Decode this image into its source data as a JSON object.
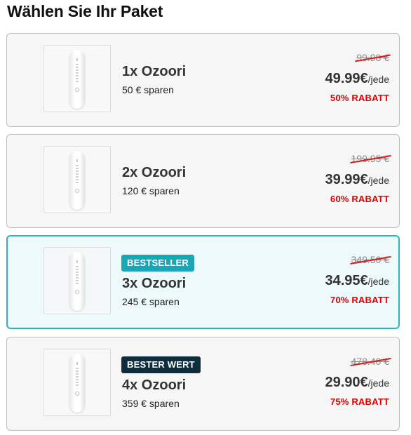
{
  "page": {
    "title": "Wählen Sie Ihr Paket"
  },
  "packages": [
    {
      "name": "1x Ozoori",
      "savings": "50 € sparen",
      "old_price": "99.98 €",
      "price": "49.99€",
      "unit": "/jede",
      "discount": "50% RABATT",
      "badge": "",
      "selected": false
    },
    {
      "name": "2x Ozoori",
      "savings": "120 € sparen",
      "old_price": "199.95 €",
      "price": "39.99€",
      "unit": "/jede",
      "discount": "60% RABATT",
      "badge": "",
      "selected": false
    },
    {
      "name": "3x Ozoori",
      "savings": "245 € sparen",
      "old_price": "349.50 €",
      "price": "34.95€",
      "unit": "/jede",
      "discount": "70% RABATT",
      "badge": "BESTSELLER",
      "selected": true
    },
    {
      "name": "4x Ozoori",
      "savings": "359 € sparen",
      "old_price": "478.40 €",
      "price": "29.90€",
      "unit": "/jede",
      "discount": "75% RABATT",
      "badge": "BESTER WERT",
      "selected": false
    }
  ],
  "colors": {
    "selected_border": "#2bb3c0",
    "bestseller_badge": "#19a7b8",
    "bester_wert_badge": "#0e2d3d",
    "discount_red": "#e00000"
  }
}
